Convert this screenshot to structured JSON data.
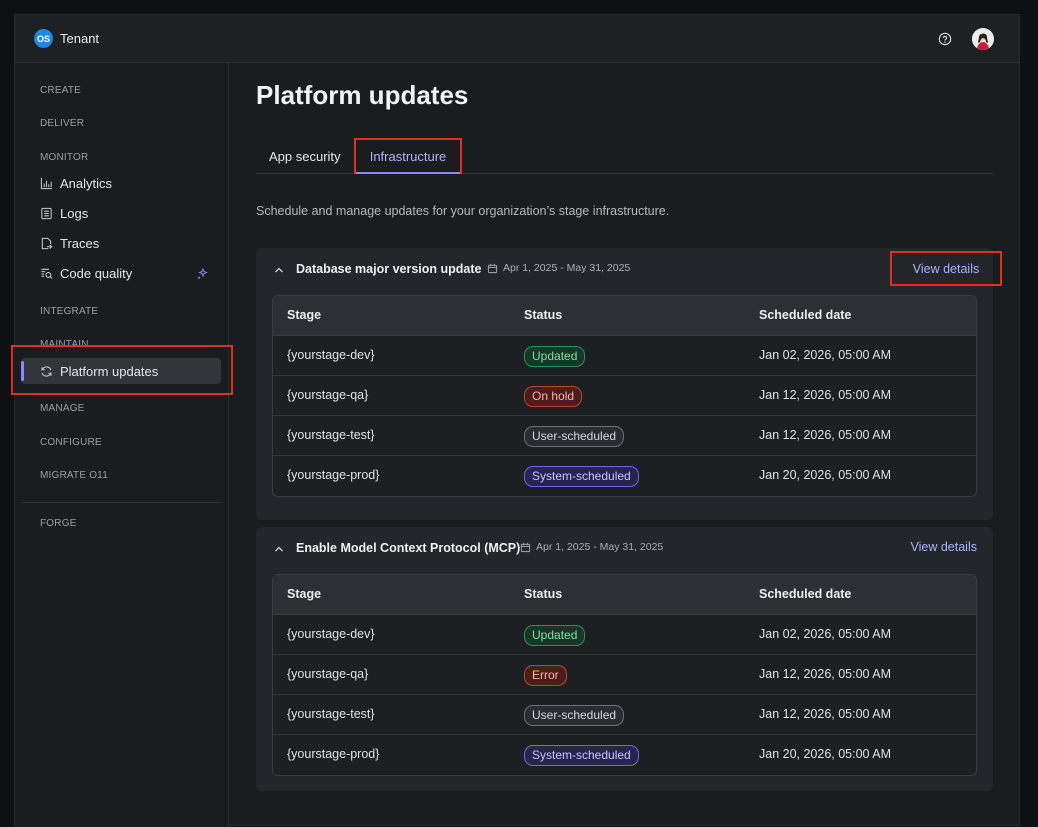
{
  "brand": {
    "logo_text": "OS",
    "name": "Tenant"
  },
  "topbar": {
    "help_icon": "question-circle-icon",
    "avatar_icon": "user-avatar-icon"
  },
  "sidebar": {
    "sections": {
      "create": "CREATE",
      "deliver": "DELIVER",
      "monitor": "MONITOR",
      "integrate": "INTEGRATE",
      "maintain": "MAINTAIN",
      "manage": "MANAGE",
      "configure": "CONFIGURE",
      "migrate": "MIGRATE O11",
      "forge": "FORGE"
    },
    "items": {
      "analytics": "Analytics",
      "logs": "Logs",
      "traces": "Traces",
      "code_quality": "Code quality",
      "platform_updates": "Platform updates"
    }
  },
  "main": {
    "title": "Platform updates",
    "tabs": [
      {
        "label": "App security"
      },
      {
        "label": "Infrastructure",
        "active": true
      }
    ],
    "description": "Schedule and manage updates for your organization’s stage infrastructure.",
    "columns": [
      "Stage",
      "Status",
      "Scheduled date"
    ],
    "cards": [
      {
        "title": "Database major version update",
        "date_range": "Apr 1, 2025 - May 31, 2025",
        "view_details": "View details",
        "rows": [
          {
            "stage": "{yourstage-dev}",
            "status": "Updated",
            "date": "Jan 02, 2026, 05:00 AM"
          },
          {
            "stage": "{yourstage-qa}",
            "status": "On hold",
            "date": "Jan 12, 2026, 05:00 AM"
          },
          {
            "stage": "{yourstage-test}",
            "status": "User-scheduled",
            "date": "Jan 12, 2026, 05:00 AM"
          },
          {
            "stage": "{yourstage-prod}",
            "status": "System-scheduled",
            "date": "Jan 20, 2026, 05:00 AM"
          }
        ]
      },
      {
        "title": "Enable Model Context Protocol (MCP)",
        "date_range": "Apr 1, 2025 - May 31, 2025",
        "view_details": "View details",
        "rows": [
          {
            "stage": "{yourstage-dev}",
            "status": "Updated",
            "date": "Jan 02, 2026, 05:00 AM"
          },
          {
            "stage": "{yourstage-qa}",
            "status": "Error",
            "date": "Jan 12, 2026, 05:00 AM"
          },
          {
            "stage": "{yourstage-test}",
            "status": "User-scheduled",
            "date": "Jan 12, 2026, 05:00 AM"
          },
          {
            "stage": "{yourstage-prod}",
            "status": "System-scheduled",
            "date": "Jan 20, 2026, 05:00 AM"
          }
        ]
      }
    ]
  },
  "status_colors": {
    "Updated": {
      "fg": "#7fe0a6",
      "bg": "#173626",
      "border": "#2f8f5a"
    },
    "On hold": {
      "fg": "#ffb3a8",
      "bg": "#4a1d1a",
      "border": "#b3443a"
    },
    "Error": {
      "fg": "#ffb3a8",
      "bg": "#4a1d1a",
      "border": "#b3443a"
    },
    "User-scheduled": {
      "fg": "#d6d8dd",
      "bg": "#2a2c31",
      "border": "#6b6f78"
    },
    "System-scheduled": {
      "fg": "#c9c4ff",
      "bg": "#27254f",
      "border": "#6f66e0"
    }
  }
}
